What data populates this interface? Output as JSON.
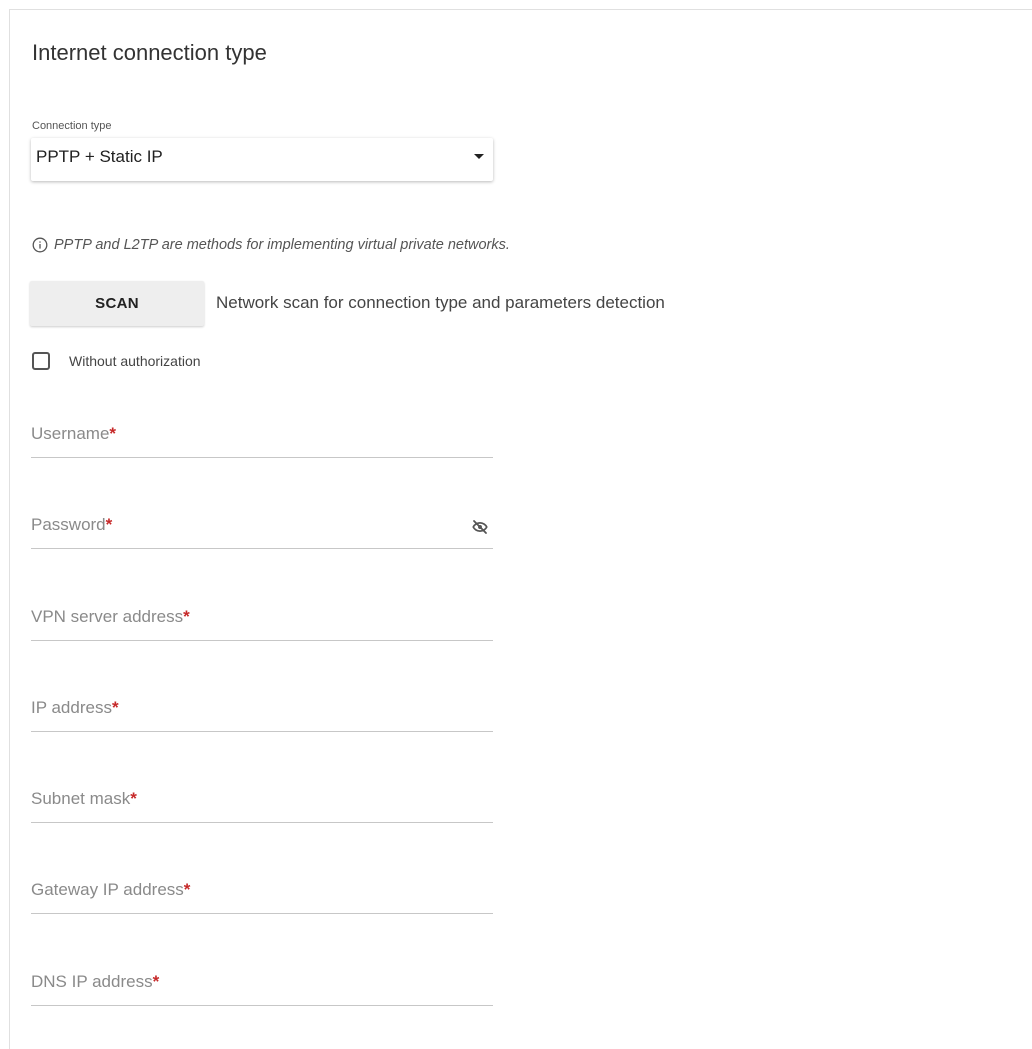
{
  "page": {
    "title": "Internet connection type"
  },
  "connection_type": {
    "caption": "Connection type",
    "selected": "PPTP + Static IP"
  },
  "info": {
    "text": "PPTP and L2TP are methods for implementing virtual private networks."
  },
  "scan": {
    "button_label": "SCAN",
    "description": "Network scan for connection type and parameters detection"
  },
  "without_authorization": {
    "label": "Without authorization",
    "checked": false
  },
  "fields": {
    "username": {
      "label": "Username",
      "required_mark": "*",
      "value": ""
    },
    "password": {
      "label": "Password",
      "required_mark": "*",
      "value": ""
    },
    "vpn_server": {
      "label": "VPN server address",
      "required_mark": "*",
      "value": ""
    },
    "ip_address": {
      "label": "IP address",
      "required_mark": "*",
      "value": ""
    },
    "subnet_mask": {
      "label": "Subnet mask",
      "required_mark": "*",
      "value": ""
    },
    "gateway_ip": {
      "label": "Gateway IP address",
      "required_mark": "*",
      "value": ""
    },
    "dns_ip": {
      "label": "DNS IP address",
      "required_mark": "*",
      "value": ""
    }
  },
  "icons": {
    "info": "info-circle-icon",
    "caret": "caret-down-icon",
    "password_toggle": "eye-off-icon"
  },
  "colors": {
    "required": "#c62828",
    "button_bg": "#eeeeee",
    "underline": "#c7c7c7"
  }
}
